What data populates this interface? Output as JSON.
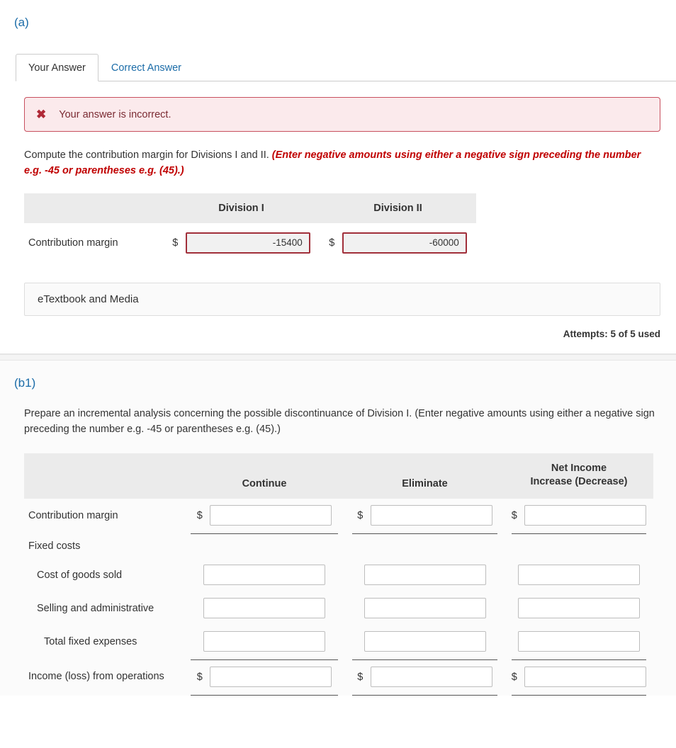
{
  "sections": {
    "a": {
      "label": "(a)",
      "tabs": [
        {
          "label": "Your Answer",
          "active": true
        },
        {
          "label": "Correct Answer",
          "active": false
        }
      ],
      "alert": {
        "icon": "x-mark-icon",
        "message": "Your answer is incorrect."
      },
      "prompt": "Compute the contribution margin for Divisions I and II.",
      "prompt_hint": "(Enter negative amounts using either a negative sign preceding the number e.g. -45 or parentheses e.g. (45).)",
      "table": {
        "headers": [
          "",
          "Division I",
          "Division II"
        ],
        "row_label": "Contribution margin",
        "currency": "$",
        "values": [
          "-15400",
          "-60000"
        ]
      },
      "etextbook_label": "eTextbook and Media",
      "attempts": "Attempts: 5 of 5 used"
    },
    "b1": {
      "label": "(b1)",
      "prompt": "Prepare an incremental analysis concerning the possible discontinuance of Division I.",
      "prompt_hint": "(Enter negative amounts using either a negative sign preceding the number e.g. -45 or parentheses e.g. (45).)",
      "table": {
        "headers": [
          "",
          "Continue",
          "Eliminate",
          "Net Income Increase (Decrease)"
        ],
        "header_net_line1": "Net Income",
        "header_net_line2": "Increase (Decrease)",
        "rows": [
          {
            "label": "Contribution margin",
            "currency": "$",
            "values": [
              "",
              "",
              ""
            ],
            "underline": true
          },
          {
            "label": "Fixed costs",
            "currency": "",
            "values": [
              null,
              null,
              null
            ],
            "underline": false
          },
          {
            "label": "Cost of goods sold",
            "currency": "",
            "values": [
              "",
              "",
              ""
            ],
            "underline": false
          },
          {
            "label": "Selling and administrative",
            "currency": "",
            "values": [
              "",
              "",
              ""
            ],
            "underline": false
          },
          {
            "label": "Total fixed expenses",
            "currency": "",
            "values": [
              "",
              "",
              ""
            ],
            "underline": true
          },
          {
            "label": "Income (loss) from operations",
            "currency": "$",
            "values": [
              "",
              "",
              ""
            ],
            "underline": true
          }
        ]
      }
    }
  },
  "colors": {
    "accent": "#1b6ca8",
    "error_border": "#c8505f",
    "error_bg": "#fbeaec",
    "hint_red": "#c00000",
    "header_bg": "#ebebeb"
  }
}
